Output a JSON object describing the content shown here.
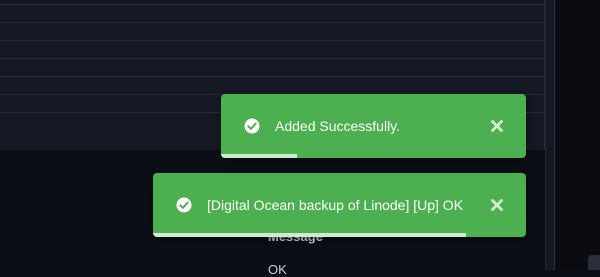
{
  "background": {
    "hidden_label": "Message",
    "hidden_value": "OK"
  },
  "notifications": [
    {
      "message": "Added Successfully.",
      "status": "success",
      "icon": "check-circle-icon",
      "close_icon": "close-icon",
      "progress": 0.25
    },
    {
      "message": "[Digital Ocean backup of Linode] [Up] OK",
      "status": "success",
      "icon": "check-circle-icon",
      "close_icon": "close-icon",
      "progress": 0.84
    }
  ],
  "colors": {
    "toast_background": "#4caf50",
    "progress_bar": "#cdeacb",
    "page_background": "#0b0e14"
  }
}
